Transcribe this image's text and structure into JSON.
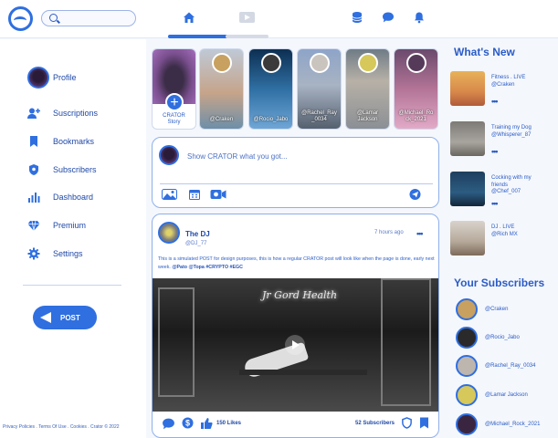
{
  "header": {
    "search_placeholder": "",
    "nav": [
      "home-icon",
      "video-icon"
    ],
    "actions": [
      "database-icon",
      "chat-icon",
      "bell-icon"
    ]
  },
  "sidebar": {
    "items": [
      {
        "label": "Profile",
        "icon": "avatar"
      },
      {
        "label": "Suscriptions",
        "icon": "add-user-icon"
      },
      {
        "label": "Bookmarks",
        "icon": "bookmark-icon"
      },
      {
        "label": "Subscribers",
        "icon": "shield-icon"
      },
      {
        "label": "Dashboard",
        "icon": "bar-chart-icon"
      },
      {
        "label": "Premium",
        "icon": "diamond-icon"
      },
      {
        "label": "Settings",
        "icon": "gear-icon"
      }
    ],
    "post_button": "POST",
    "footer": "Privacy Policies . Terms Of Use . Cookies . Crator © 2022"
  },
  "stories": [
    {
      "label": "CRATOR\nStory",
      "create": true
    },
    {
      "label": "@Craken",
      "bg": "linear-gradient(180deg,#bfc9d6 0%,#c6a48a 55%,#6d8fa8 100%)",
      "av": "#c8a060"
    },
    {
      "label": "@Rocio_Jabo",
      "bg": "linear-gradient(180deg,#0d2f52 0%,#2f6fa3 50%,#6fa6d6 100%)",
      "av": "#3b3b3b"
    },
    {
      "label": "@Rachel_Ray\n_0034",
      "bg": "linear-gradient(180deg,#8ea4c8 0%,#a8b3c3 45%,#55606f 100%)",
      "av": "#c9c4be"
    },
    {
      "label": "@Lamar\nJackson",
      "bg": "linear-gradient(180deg,#6f7b86 0%,#b7b1a7 40%,#8b8f94 100%)",
      "av": "#d6c85a"
    },
    {
      "label": "@Michael_Ro\nck_2021",
      "bg": "linear-gradient(180deg,#6a4a6c 0%,#b37497 50%,#e2aac7 100%)",
      "av": "#553a5a"
    }
  ],
  "composer": {
    "prompt": "Show CRATOR what you got...",
    "tools": [
      "image-icon",
      "calendar-icon",
      "camera-icon"
    ],
    "send": "send-icon"
  },
  "post": {
    "name": "The DJ",
    "handle": "@DJ_77",
    "time": "7 hours ago",
    "text": "This is a simulated POST for design purposes, this is how a regular CRATOR post will look like when the page is done, early next week.",
    "tags": "@Pato @Topa #CRYPTO #EGC",
    "neon": "Jr Gord Health",
    "likes": "150 Likes",
    "subscribers": "52 Subscribers"
  },
  "whats_new": {
    "title": "What's New",
    "items": [
      {
        "text": "Fitness . LIVE\n@Craken",
        "thumb": "linear-gradient(180deg,#e8b25a 0%,#d8884a 60%,#b05a3a 100%)"
      },
      {
        "text": "Training my Dog\n@Whisperer_87",
        "thumb": "linear-gradient(180deg,#7d7a76 0%,#a8a59f 60%,#6a6660 100%)"
      },
      {
        "text": "Cocking with my\nfriends\n@Chef_007",
        "thumb": "linear-gradient(180deg,#1e3f5e 0%,#2c5c82 60%,#12263a 100%)"
      },
      {
        "text": "DJ . LIVE\n@Rich MX",
        "thumb": "linear-gradient(180deg,#d9d3cc 0%,#b6a99a 60%,#7d6a5a 100%)"
      }
    ]
  },
  "subscribers": {
    "title": "Your Subscribers",
    "items": [
      {
        "name": "@Craken",
        "av": "#c8a060"
      },
      {
        "name": "@Rocio_Jabo",
        "av": "#2a2a2a"
      },
      {
        "name": "@Rachel_Ray_0034",
        "av": "#bdb6ae"
      },
      {
        "name": "@Lamar Jackson",
        "av": "#d6c85a"
      },
      {
        "name": "@Michael_Rock_2021",
        "av": "#3a2540"
      }
    ]
  },
  "colors": {
    "accent": "#2f6fe0",
    "text": "#2b5cc6",
    "bg": "#f4f7fc"
  }
}
